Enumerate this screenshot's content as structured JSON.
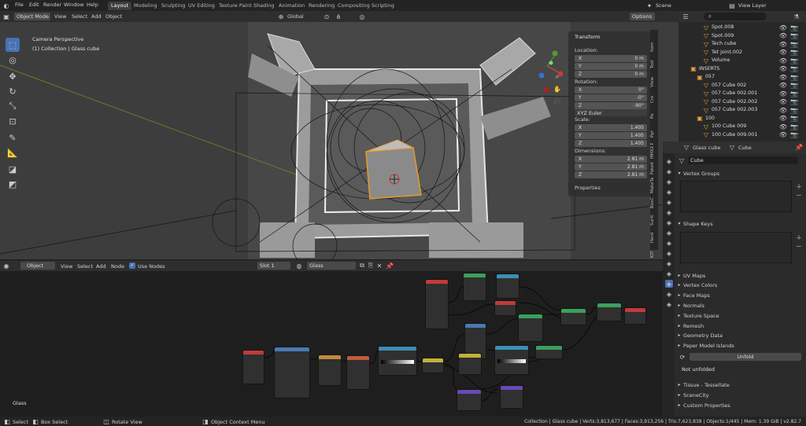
{
  "menu": [
    "File",
    "Edit",
    "Render",
    "Window",
    "Help"
  ],
  "workspaces": [
    "Layout",
    "Modeling",
    "Sculpting",
    "UV Editing",
    "Texture Paint",
    "Shading",
    "Animation",
    "Rendering",
    "Compositing",
    "Scripting"
  ],
  "scene": "Scene",
  "view_layer": "View Layer",
  "viewport": {
    "mode": "Object Mode",
    "menus": [
      "View",
      "Select",
      "Add",
      "Object"
    ],
    "orientation": "Global",
    "options": "Options",
    "overlay_line1": "Camera Perspective",
    "overlay_line2": "(1) Collection | Glass cube",
    "tabs": [
      "Item",
      "Tool",
      "View",
      "Cre",
      "Pa",
      "Ppr",
      "MHX2 R",
      "Fakeit",
      "MakeTa",
      "BoxC",
      "Surfc",
      "Hard",
      "KIT"
    ]
  },
  "transform": {
    "title": "Transform",
    "location_label": "Location:",
    "loc": [
      {
        "a": "X",
        "v": "0 m"
      },
      {
        "a": "Y",
        "v": "0 m"
      },
      {
        "a": "Z",
        "v": "0 m"
      }
    ],
    "rotation_label": "Rotation:",
    "rot": [
      {
        "a": "X",
        "v": "0°"
      },
      {
        "a": "Y",
        "v": "-0°"
      },
      {
        "a": "Z",
        "v": "-90°"
      }
    ],
    "rot_mode": "XYZ Euler",
    "scale_label": "Scale:",
    "scale": [
      {
        "a": "X",
        "v": "1.405"
      },
      {
        "a": "Y",
        "v": "1.405"
      },
      {
        "a": "Z",
        "v": "1.405"
      }
    ],
    "dim_label": "Dimensions:",
    "dim": [
      {
        "a": "X",
        "v": "2.81 m"
      },
      {
        "a": "Y",
        "v": "2.81 m"
      },
      {
        "a": "Z",
        "v": "2.81 m"
      }
    ],
    "properties": "Properties"
  },
  "node_editor": {
    "type": "Object",
    "menus": [
      "View",
      "Select",
      "Add",
      "Node"
    ],
    "use_nodes": "Use Nodes",
    "slot": "Slot 1",
    "material": "Glass",
    "label": "Glass"
  },
  "outliner": [
    {
      "name": "Spot.008",
      "indent": 3
    },
    {
      "name": "Spot.009",
      "indent": 3
    },
    {
      "name": "Tech cube",
      "indent": 3
    },
    {
      "name": "Tet joint.002",
      "indent": 3
    },
    {
      "name": "Volume",
      "indent": 3
    },
    {
      "name": "INSERTS",
      "indent": 1
    },
    {
      "name": "057",
      "indent": 2
    },
    {
      "name": "057 Cube 002",
      "indent": 3
    },
    {
      "name": "057 Cube 002.001",
      "indent": 3
    },
    {
      "name": "057 Cube 002.002",
      "indent": 3
    },
    {
      "name": "057 Cube 002.003",
      "indent": 3
    },
    {
      "name": "100",
      "indent": 2
    },
    {
      "name": "100 Cube 009",
      "indent": 3
    },
    {
      "name": "100 Cube 009.001",
      "indent": 3
    }
  ],
  "props": {
    "object": "Glass cube",
    "data": "Cube",
    "mesh_name": "Cube",
    "sections": [
      "Vertex Groups",
      "Shape Keys",
      "UV Maps",
      "Vertex Colors",
      "Face Maps",
      "Normals",
      "Texture Space",
      "Remesh",
      "Geometry Data",
      "Paper Model Islands"
    ],
    "unfold": "Unfold",
    "not_unfolded": "Not unfolded",
    "more_sections": [
      "Tissue - Tessellate",
      "SceneCity",
      "Custom Properties"
    ]
  },
  "status": {
    "left": [
      {
        "k": "Select"
      },
      {
        "k": "Box Select"
      },
      {
        "k": "Rotate View"
      },
      {
        "k": "Object Context Menu"
      }
    ],
    "stats": "Collection | Glass cube | Verts:3,813,677 | Faces:3,913,256 | Tris:7,623,838 | Objects:1/445 | Mem: 1.39 GiB | v2.82.7"
  }
}
